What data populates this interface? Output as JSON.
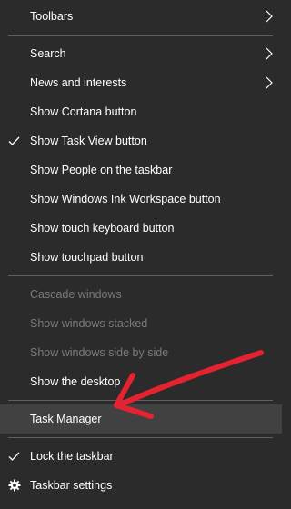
{
  "menu": {
    "items": [
      {
        "label": "Toolbars"
      },
      {
        "label": "Search"
      },
      {
        "label": "News and interests"
      },
      {
        "label": "Show Cortana button"
      },
      {
        "label": "Show Task View button"
      },
      {
        "label": "Show People on the taskbar"
      },
      {
        "label": "Show Windows Ink Workspace button"
      },
      {
        "label": "Show touch keyboard button"
      },
      {
        "label": "Show touchpad button"
      },
      {
        "label": "Cascade windows"
      },
      {
        "label": "Show windows stacked"
      },
      {
        "label": "Show windows side by side"
      },
      {
        "label": "Show the desktop"
      },
      {
        "label": "Task Manager"
      },
      {
        "label": "Lock the taskbar"
      },
      {
        "label": "Taskbar settings"
      }
    ]
  },
  "colors": {
    "menu_background": "#2b2b2b",
    "highlight_background": "#414141",
    "text": "#ffffff",
    "disabled_text": "#7a7a7a",
    "separator": "#5f5f5f",
    "annotation_arrow": "#e5222f"
  },
  "icons": {
    "submenu": "chevron-right-icon",
    "checked": "checkmark-icon",
    "settings": "gear-icon",
    "annotation": "red-arrow"
  },
  "checked_items": [
    "Show Task View button",
    "Lock the taskbar"
  ],
  "disabled_items": [
    "Cascade windows",
    "Show windows stacked",
    "Show windows side by side"
  ],
  "highlighted_item": "Task Manager"
}
